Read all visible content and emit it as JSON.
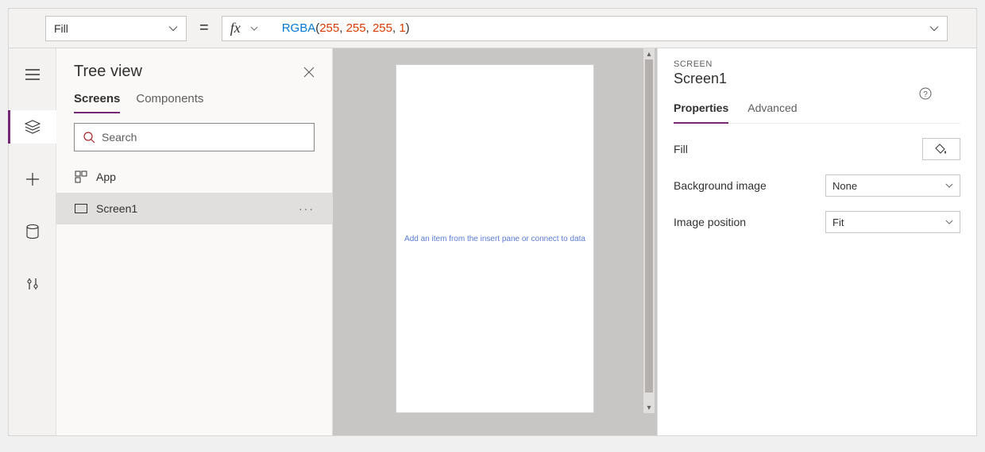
{
  "formula_bar": {
    "property": "Fill",
    "fx_label": "fx",
    "formula_fn": "RGBA",
    "formula_args": [
      "255",
      "255",
      "255",
      "1"
    ]
  },
  "tree": {
    "title": "Tree view",
    "tabs": {
      "screens": "Screens",
      "components": "Components"
    },
    "search_placeholder": "Search",
    "items": [
      {
        "label": "App"
      },
      {
        "label": "Screen1"
      }
    ],
    "more": "···"
  },
  "canvas": {
    "placeholder": "Add an item from the insert pane or connect to data"
  },
  "props": {
    "crumb": "SCREEN",
    "name": "Screen1",
    "tabs": {
      "properties": "Properties",
      "advanced": "Advanced"
    },
    "rows": {
      "fill_label": "Fill",
      "bgimg_label": "Background image",
      "bgimg_value": "None",
      "imgpos_label": "Image position",
      "imgpos_value": "Fit"
    }
  }
}
